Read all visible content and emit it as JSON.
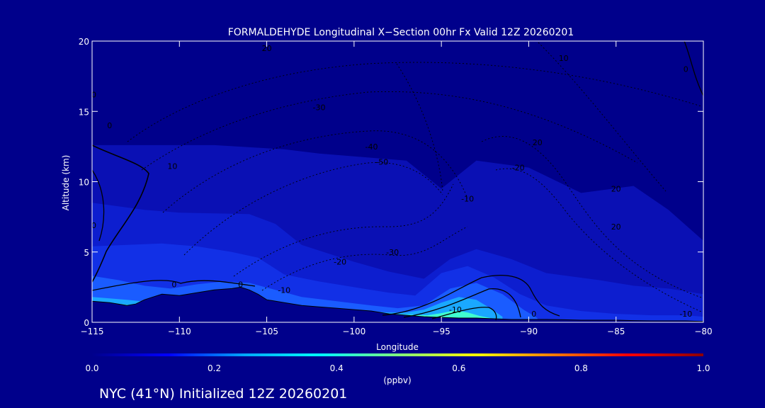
{
  "chart_data": {
    "type": "heatmap",
    "title": "FORMALDEHYDE Longitudinal X−Section 00hr  Fx Valid 12Z 20260201",
    "xlabel": "Longitude",
    "ylabel": "Altitude (km)",
    "xlim": [
      -115,
      -80
    ],
    "ylim": [
      0,
      20
    ],
    "x_ticks": [
      -115,
      -110,
      -105,
      -100,
      -95,
      -90,
      -85,
      -80
    ],
    "x_tick_labels": [
      "−115",
      "−110",
      "−105",
      "−100",
      "−95",
      "−90",
      "−85",
      "−80"
    ],
    "y_ticks": [
      0,
      5,
      10,
      15,
      20
    ],
    "y_tick_labels": [
      "0",
      "5",
      "10",
      "15",
      "20"
    ],
    "colorbar": {
      "min": 0.0,
      "max": 1.0,
      "ticks": [
        0.0,
        0.2,
        0.4,
        0.6,
        0.8,
        1.0
      ],
      "tick_labels": [
        "0.0",
        "0.2",
        "0.4",
        "0.6",
        "0.8",
        "1.0"
      ],
      "unit_label": "(ppbv)",
      "colors": [
        "#00008b",
        "#0000ff",
        "#00aaff",
        "#00ffff",
        "#7fff7f",
        "#ffff00",
        "#ff8000",
        "#ff0000",
        "#8b0000"
      ]
    },
    "terrain_profile": {
      "lon": [
        -115,
        -114,
        -113,
        -112.5,
        -112,
        -111,
        -110,
        -109,
        -108,
        -107,
        -106.5,
        -106,
        -105.5,
        -105,
        -104,
        -103,
        -102,
        -101,
        -100,
        -99,
        -98,
        -97,
        -96,
        -95,
        -94,
        -93,
        -92,
        -91,
        -90,
        -89,
        -88,
        -87,
        -86,
        -85,
        -84,
        -83,
        -82,
        -81,
        -80
      ],
      "alt": [
        1.5,
        1.4,
        1.2,
        1.3,
        1.6,
        2.0,
        1.9,
        2.1,
        2.3,
        2.4,
        2.5,
        2.3,
        2.0,
        1.6,
        1.4,
        1.2,
        1.1,
        1.0,
        0.9,
        0.8,
        0.6,
        0.5,
        0.4,
        0.35,
        0.3,
        0.3,
        0.25,
        0.2,
        0.2,
        0.2,
        0.18,
        0.15,
        0.15,
        0.15,
        0.12,
        0.1,
        0.1,
        0.1,
        0.05
      ]
    },
    "concentration_layers": [
      {
        "level": 0.05,
        "color": "#0a10b4",
        "lon": [
          -115,
          -112,
          -108,
          -104,
          -102,
          -97,
          -95,
          -93,
          -90,
          -87,
          -84,
          -82,
          -80
        ],
        "alt_top": [
          12.6,
          12.6,
          12.6,
          12.3,
          12.0,
          11.5,
          9.5,
          11.5,
          11.0,
          9.2,
          9.7,
          8.0,
          5.8
        ]
      },
      {
        "level": 0.1,
        "color": "#0d1ecf",
        "lon": [
          -115,
          -112,
          -110,
          -106,
          -104.5,
          -103,
          -100,
          -98,
          -96,
          -94.5,
          -93,
          -91,
          -89,
          -86,
          -84,
          -82,
          -80
        ],
        "alt_top": [
          8.5,
          8.0,
          7.8,
          7.7,
          7.0,
          5.5,
          4.3,
          3.6,
          3.1,
          4.5,
          5.2,
          4.5,
          3.5,
          3.0,
          2.6,
          2.4,
          2.0
        ]
      },
      {
        "level": 0.15,
        "color": "#1230e6",
        "lon": [
          -115,
          -113,
          -111,
          -109,
          -107,
          -105.5,
          -104,
          -102,
          -100,
          -98,
          -96.5,
          -95,
          -93.5,
          -92,
          -90.5,
          -89,
          -87,
          -85,
          -83,
          -81,
          -80
        ],
        "alt_top": [
          5.4,
          5.5,
          5.6,
          5.4,
          5.0,
          4.6,
          3.4,
          2.9,
          2.5,
          2.1,
          1.9,
          3.5,
          4.0,
          3.2,
          2.0,
          1.2,
          0.8,
          0.6,
          0.5,
          0.5,
          0.4
        ]
      },
      {
        "level": 0.25,
        "color": "#1a5cff",
        "lon": [
          -115,
          -113.5,
          -112,
          -110.5,
          -109,
          -107.5,
          -106,
          -104.5,
          -103,
          -101,
          -99,
          -97.5,
          -96,
          -94.5,
          -93,
          -91.5,
          -90.3,
          -89.5
        ],
        "alt_top": [
          3.3,
          3.0,
          2.6,
          2.4,
          2.7,
          2.9,
          2.8,
          2.3,
          1.8,
          1.5,
          1.2,
          1.0,
          1.2,
          2.4,
          2.8,
          2.0,
          0.9,
          0.3
        ]
      },
      {
        "level": 0.35,
        "color": "#1aa8ff",
        "lon": [
          -115,
          -114,
          -113,
          -112.2,
          -98,
          -97,
          -96,
          -95,
          -94,
          -93,
          -92.2,
          -91.5
        ],
        "alt_top": [
          1.8,
          1.7,
          1.6,
          1.5,
          0.7,
          0.7,
          0.9,
          1.4,
          1.8,
          1.6,
          1.0,
          0.4
        ]
      },
      {
        "level": 0.45,
        "color": "#40ffd0",
        "lon": [
          -114.5,
          -113.8,
          -113,
          -112.6,
          -95.8,
          -95,
          -94.2,
          -93.5,
          -92.8,
          -92.2
        ],
        "alt_top": [
          1.45,
          1.35,
          1.25,
          1.2,
          0.5,
          0.65,
          0.85,
          0.7,
          0.45,
          0.3
        ]
      }
    ],
    "contours": [
      {
        "label": "20",
        "label_lon": -105,
        "label_alt": 19.5
      },
      {
        "label": "10",
        "label_lon": -88,
        "label_alt": 18.8
      },
      {
        "label": "-30",
        "label_lon": -102,
        "label_alt": 15.3
      },
      {
        "label": "-40",
        "label_lon": -99,
        "label_alt": 12.5
      },
      {
        "label": "-50",
        "label_lon": -98.4,
        "label_alt": 11.4
      },
      {
        "label": "10",
        "label_lon": -110.4,
        "label_alt": 11.1
      },
      {
        "label": "20",
        "label_lon": -89.5,
        "label_alt": 12.8
      },
      {
        "label": "-20",
        "label_lon": -90.6,
        "label_alt": 11.0
      },
      {
        "label": "-10",
        "label_lon": -93.5,
        "label_alt": 8.8
      },
      {
        "label": "20",
        "label_lon": -85,
        "label_alt": 9.5
      },
      {
        "label": "20",
        "label_lon": -85,
        "label_alt": 6.8
      },
      {
        "label": "-30",
        "label_lon": -97.8,
        "label_alt": 5.0
      },
      {
        "label": "-20",
        "label_lon": -100.8,
        "label_alt": 4.3
      },
      {
        "label": "-10",
        "label_lon": -104,
        "label_alt": 2.3
      },
      {
        "label": "-10",
        "label_lon": -94.2,
        "label_alt": 0.9
      },
      {
        "label": "0",
        "label_lon": -106.5,
        "label_alt": 2.7
      },
      {
        "label": "0",
        "label_lon": -110.3,
        "label_alt": 2.7
      },
      {
        "label": "0",
        "label_lon": -89.7,
        "label_alt": 0.6
      },
      {
        "label": "-10",
        "label_lon": -81,
        "label_alt": 0.6
      },
      {
        "label": "0",
        "label_lon": -114,
        "label_alt": 14.0
      },
      {
        "label": "0",
        "label_lon": -114.9,
        "label_alt": 6.9
      },
      {
        "label": "0",
        "label_lon": -114.9,
        "label_alt": 16.2
      },
      {
        "label": "0",
        "label_lon": -81,
        "label_alt": 18.0
      }
    ]
  },
  "footer": {
    "caption": "NYC (41°N) Initialized 12Z 20260201"
  }
}
